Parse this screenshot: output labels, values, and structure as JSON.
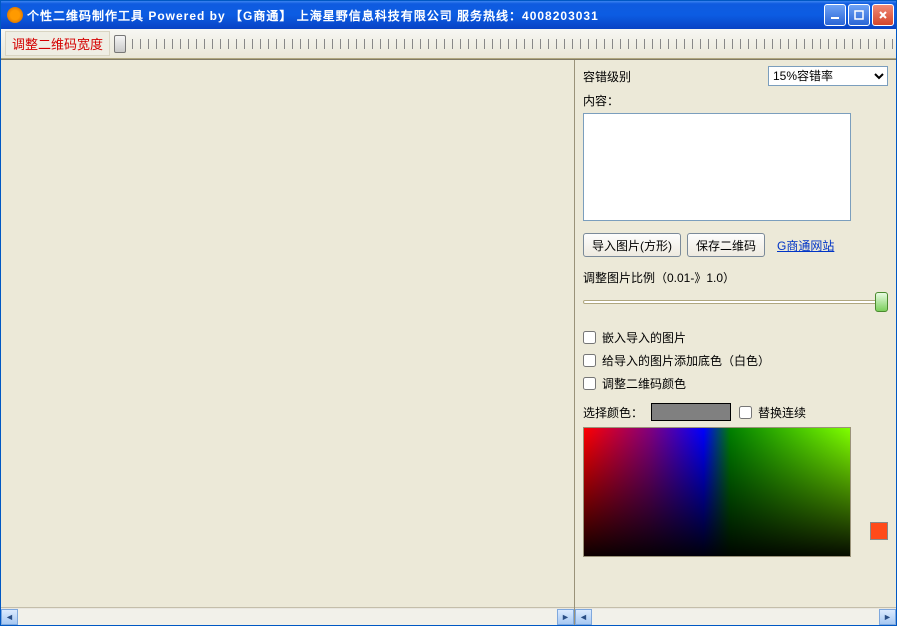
{
  "titlebar": {
    "title": "个性二维码制作工具   Powered by 【G商通】  上海星野信息科技有限公司 服务热线：4008203031"
  },
  "toolbar": {
    "width_label": "调整二维码宽度"
  },
  "right": {
    "error_label": "容错级别",
    "error_value": "15%容错率",
    "content_label": "内容：",
    "content_value": "",
    "import_btn": "导入图片(方形)",
    "save_btn": "保存二维码",
    "website_link": "G商通网站",
    "ratio_label": "调整图片比例（0.01-》1.0）",
    "chk_embed": "嵌入导入的图片",
    "chk_bg": "给导入的图片添加底色（白色）",
    "chk_color": "调整二维码颜色",
    "select_color_label": "选择颜色：",
    "chk_continuous": "替换连续"
  }
}
